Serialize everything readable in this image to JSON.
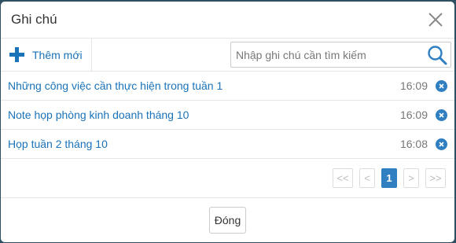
{
  "dialog": {
    "title": "Ghi chú"
  },
  "toolbar": {
    "add_label": "Thêm mới",
    "search_placeholder": "Nhập ghi chú cần tìm kiếm",
    "search_value": ""
  },
  "notes": [
    {
      "title": "Những công việc cần thực hiện trong tuần 1",
      "time": "16:09"
    },
    {
      "title": "Note họp phòng kinh doanh tháng 10",
      "time": "16:09"
    },
    {
      "title": "Họp tuần 2 tháng 10",
      "time": "16:08"
    }
  ],
  "pager": {
    "first": "<<",
    "prev": "<",
    "current": "1",
    "next": ">",
    "last": ">>"
  },
  "footer": {
    "close_label": "Đóng"
  },
  "colors": {
    "accent": "#2f7fc1",
    "link": "#1a73b8",
    "backdrop": "#2f4f63"
  },
  "icons": [
    "plus-icon",
    "search-icon",
    "close-icon",
    "delete-icon"
  ]
}
